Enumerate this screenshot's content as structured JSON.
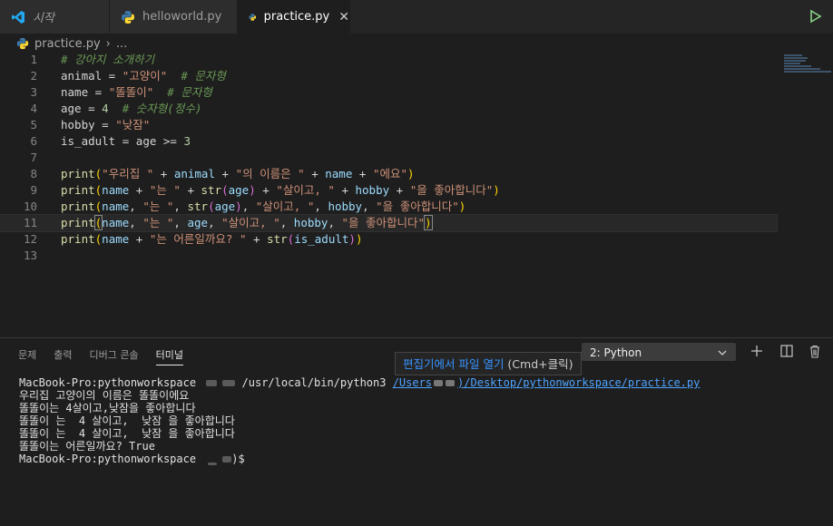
{
  "tabs": [
    {
      "label": "시작",
      "icon": "vscode-icon"
    },
    {
      "label": "helloworld.py",
      "icon": "python-icon"
    },
    {
      "label": "practice.py",
      "icon": "python-icon",
      "close": "✕"
    }
  ],
  "breadcrumb": {
    "file": "practice.py",
    "sep": "›",
    "rest": "..."
  },
  "editor": {
    "line_numbers": [
      "1",
      "2",
      "3",
      "4",
      "5",
      "6",
      "7",
      "8",
      "9",
      "10",
      "11",
      "12",
      "13"
    ],
    "lines": [
      [
        {
          "t": "# 강아지 소개하기",
          "c": "cm"
        }
      ],
      [
        {
          "t": "animal",
          "c": "op"
        },
        {
          "t": " = ",
          "c": "op"
        },
        {
          "t": "\"고양이\"",
          "c": "str"
        },
        {
          "t": "  # 문자형",
          "c": "cm"
        }
      ],
      [
        {
          "t": "name",
          "c": "op"
        },
        {
          "t": " = ",
          "c": "op"
        },
        {
          "t": "\"똘똘이\"",
          "c": "str"
        },
        {
          "t": "  # 문자형",
          "c": "cm"
        }
      ],
      [
        {
          "t": "age",
          "c": "op"
        },
        {
          "t": " = ",
          "c": "op"
        },
        {
          "t": "4",
          "c": "num"
        },
        {
          "t": "  # 숫자형(정수)",
          "c": "cm"
        }
      ],
      [
        {
          "t": "hobby",
          "c": "op"
        },
        {
          "t": " = ",
          "c": "op"
        },
        {
          "t": "\"낮잠\"",
          "c": "str"
        }
      ],
      [
        {
          "t": "is_adult",
          "c": "op"
        },
        {
          "t": " = ",
          "c": "op"
        },
        {
          "t": "age",
          "c": "op"
        },
        {
          "t": " >= ",
          "c": "op"
        },
        {
          "t": "3",
          "c": "num"
        }
      ],
      [],
      [
        {
          "t": "print",
          "c": "fn"
        },
        {
          "t": "(",
          "c": "pn"
        },
        {
          "t": "\"우리집 \"",
          "c": "str"
        },
        {
          "t": " + ",
          "c": "op"
        },
        {
          "t": "animal",
          "c": "var"
        },
        {
          "t": " + ",
          "c": "op"
        },
        {
          "t": "\"의 이름은 \"",
          "c": "str"
        },
        {
          "t": " + ",
          "c": "op"
        },
        {
          "t": "name",
          "c": "var"
        },
        {
          "t": " + ",
          "c": "op"
        },
        {
          "t": "\"에요\"",
          "c": "str"
        },
        {
          "t": ")",
          "c": "pn"
        }
      ],
      [
        {
          "t": "print",
          "c": "fn"
        },
        {
          "t": "(",
          "c": "pn"
        },
        {
          "t": "name",
          "c": "var"
        },
        {
          "t": " + ",
          "c": "op"
        },
        {
          "t": "\"는 \"",
          "c": "str"
        },
        {
          "t": " + ",
          "c": "op"
        },
        {
          "t": "str",
          "c": "fn"
        },
        {
          "t": "(",
          "c": "pm"
        },
        {
          "t": "age",
          "c": "var"
        },
        {
          "t": ")",
          "c": "pm"
        },
        {
          "t": " + ",
          "c": "op"
        },
        {
          "t": "\"살이고, \"",
          "c": "str"
        },
        {
          "t": " + ",
          "c": "op"
        },
        {
          "t": "hobby",
          "c": "var"
        },
        {
          "t": " + ",
          "c": "op"
        },
        {
          "t": "\"을 좋아합니다\"",
          "c": "str"
        },
        {
          "t": ")",
          "c": "pn"
        }
      ],
      [
        {
          "t": "print",
          "c": "fn"
        },
        {
          "t": "(",
          "c": "pn"
        },
        {
          "t": "name",
          "c": "var"
        },
        {
          "t": ", ",
          "c": "op"
        },
        {
          "t": "\"는 \"",
          "c": "str"
        },
        {
          "t": ", ",
          "c": "op"
        },
        {
          "t": "str",
          "c": "fn"
        },
        {
          "t": "(",
          "c": "pm"
        },
        {
          "t": "age",
          "c": "var"
        },
        {
          "t": ")",
          "c": "pm"
        },
        {
          "t": ", ",
          "c": "op"
        },
        {
          "t": "\"살이고, \"",
          "c": "str"
        },
        {
          "t": ", ",
          "c": "op"
        },
        {
          "t": "hobby",
          "c": "var"
        },
        {
          "t": ", ",
          "c": "op"
        },
        {
          "t": "\"을 좋아합니다\"",
          "c": "str"
        },
        {
          "t": ")",
          "c": "pn"
        }
      ],
      [
        {
          "t": "print",
          "c": "fn"
        },
        {
          "t": "(",
          "c": "pn bracket-hl"
        },
        {
          "t": "name",
          "c": "var"
        },
        {
          "t": ", ",
          "c": "op"
        },
        {
          "t": "\"는 \"",
          "c": "str"
        },
        {
          "t": ", ",
          "c": "op"
        },
        {
          "t": "age",
          "c": "var"
        },
        {
          "t": ", ",
          "c": "op"
        },
        {
          "t": "\"살이고, \"",
          "c": "str"
        },
        {
          "t": ", ",
          "c": "op"
        },
        {
          "t": "hobby",
          "c": "var"
        },
        {
          "t": ", ",
          "c": "op"
        },
        {
          "t": "\"을 좋아합니다\"",
          "c": "str"
        },
        {
          "t": ")",
          "c": "pn bracket-hl"
        }
      ],
      [
        {
          "t": "print",
          "c": "fn"
        },
        {
          "t": "(",
          "c": "pn"
        },
        {
          "t": "name",
          "c": "var"
        },
        {
          "t": " + ",
          "c": "op"
        },
        {
          "t": "\"는 어른일까요? \"",
          "c": "str"
        },
        {
          "t": " + ",
          "c": "op"
        },
        {
          "t": "str",
          "c": "fn"
        },
        {
          "t": "(",
          "c": "pm"
        },
        {
          "t": "is_adult",
          "c": "var"
        },
        {
          "t": ")",
          "c": "pm"
        },
        {
          "t": ")",
          "c": "pn"
        }
      ],
      []
    ]
  },
  "panel": {
    "tabs": [
      "문제",
      "출력",
      "디버그 콘솔",
      "터미널"
    ],
    "terminal_select": "2: Python",
    "tooltip": {
      "link": "편집기에서 파일 열기",
      "shortcut": " (Cmd+클릭)"
    },
    "terminal": {
      "cmd_prefix": "MacBook-Pro:pythonworkspace ",
      "cmd_python": " /usr/local/bin/python3 ",
      "path_a": "/Users",
      "path_b": ")/Desktop/pythonworkspace/practice.py",
      "outputs": [
        "우리집 고양이의 이름은 똘똘이에요",
        "똘똘이는 4살이고,낮잠을 좋아합니다",
        "똘똘이 는  4 살이고,  낮잠 을 좋아합니다",
        "똘똘이 는  4 살이고,  낮잠 을 좋아합니다",
        "똘똘이는 어른일까요? True"
      ],
      "prompt": "MacBook-Pro:pythonworkspace ",
      "prompt_end": ")$"
    }
  },
  "colors": {
    "accent": "#3794ff",
    "run": "#89d185"
  }
}
